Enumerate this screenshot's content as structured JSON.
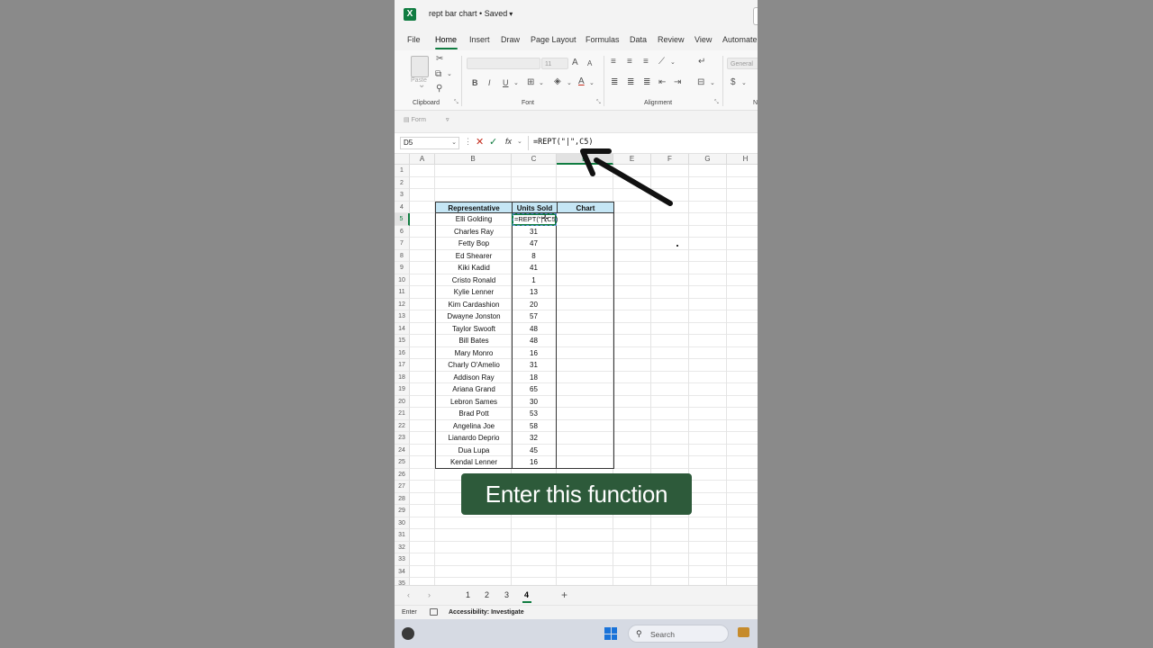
{
  "title": {
    "file": "rept bar chart",
    "status": "Saved"
  },
  "ribbon_tabs": [
    "File",
    "Home",
    "Insert",
    "Draw",
    "Page Layout",
    "Formulas",
    "Data",
    "Review",
    "View",
    "Automate"
  ],
  "ribbon": {
    "font_size": "11",
    "number_format": "General",
    "paste_label": "Paste",
    "groups": {
      "clipboard": "Clipboard",
      "font": "Font",
      "alignment": "Alignment"
    },
    "buttons": {
      "bold": "B",
      "italic": "I",
      "underline": "U",
      "grow": "A",
      "shrink": "A",
      "currency": "$"
    }
  },
  "qat": {
    "form_label": "Form"
  },
  "formula_bar": {
    "name_box": "D5",
    "fx": "fx",
    "formula": "=REPT(\"|\",C5)"
  },
  "columns": [
    "A",
    "B",
    "C",
    "D",
    "E",
    "F",
    "G",
    "H"
  ],
  "rows": [
    "1",
    "2",
    "3",
    "4",
    "5",
    "6",
    "7",
    "8",
    "9",
    "10",
    "11",
    "12",
    "13",
    "14",
    "15",
    "16",
    "17",
    "18",
    "19",
    "20",
    "21",
    "22",
    "23",
    "24",
    "25",
    "26",
    "27",
    "28",
    "29",
    "30",
    "31",
    "32",
    "33",
    "34",
    "35"
  ],
  "table": {
    "headers": [
      "Representative",
      "Units Sold",
      "Chart"
    ],
    "active_cell_text": "=REPT(\"|\",C5)",
    "rows": [
      {
        "name": "Elli Golding",
        "units": "54"
      },
      {
        "name": "Charles Ray",
        "units": "31"
      },
      {
        "name": "Fetty Bop",
        "units": "47"
      },
      {
        "name": "Ed Shearer",
        "units": "8"
      },
      {
        "name": "Kiki Kadid",
        "units": "41"
      },
      {
        "name": "Cristo Ronald",
        "units": "1"
      },
      {
        "name": "Kylie Lenner",
        "units": "13"
      },
      {
        "name": "Kim Cardashion",
        "units": "20"
      },
      {
        "name": "Dwayne Jonston",
        "units": "57"
      },
      {
        "name": "Taylor Swooft",
        "units": "48"
      },
      {
        "name": "Bill Bates",
        "units": "48"
      },
      {
        "name": "Mary Monro",
        "units": "16"
      },
      {
        "name": "Charly O'Amelio",
        "units": "31"
      },
      {
        "name": "Addison Ray",
        "units": "18"
      },
      {
        "name": "Ariana Grand",
        "units": "65"
      },
      {
        "name": "Lebron Sames",
        "units": "30"
      },
      {
        "name": "Brad Pott",
        "units": "53"
      },
      {
        "name": "Angelina Joe",
        "units": "58"
      },
      {
        "name": "Lianardo Deprio",
        "units": "32"
      },
      {
        "name": "Dua Lupa",
        "units": "45"
      },
      {
        "name": "Kendal Lenner",
        "units": "16"
      }
    ]
  },
  "caption": "Enter this function",
  "sheet_tabs": [
    "1",
    "2",
    "3",
    "4"
  ],
  "active_sheet": "4",
  "status": {
    "mode": "Enter",
    "accessibility": "Accessibility: Investigate"
  },
  "taskbar": {
    "search": "Search"
  },
  "colors": {
    "excel_green": "#107c41",
    "header_fill": "#c5e6f5",
    "caption_bg": "#2d5a3a"
  }
}
